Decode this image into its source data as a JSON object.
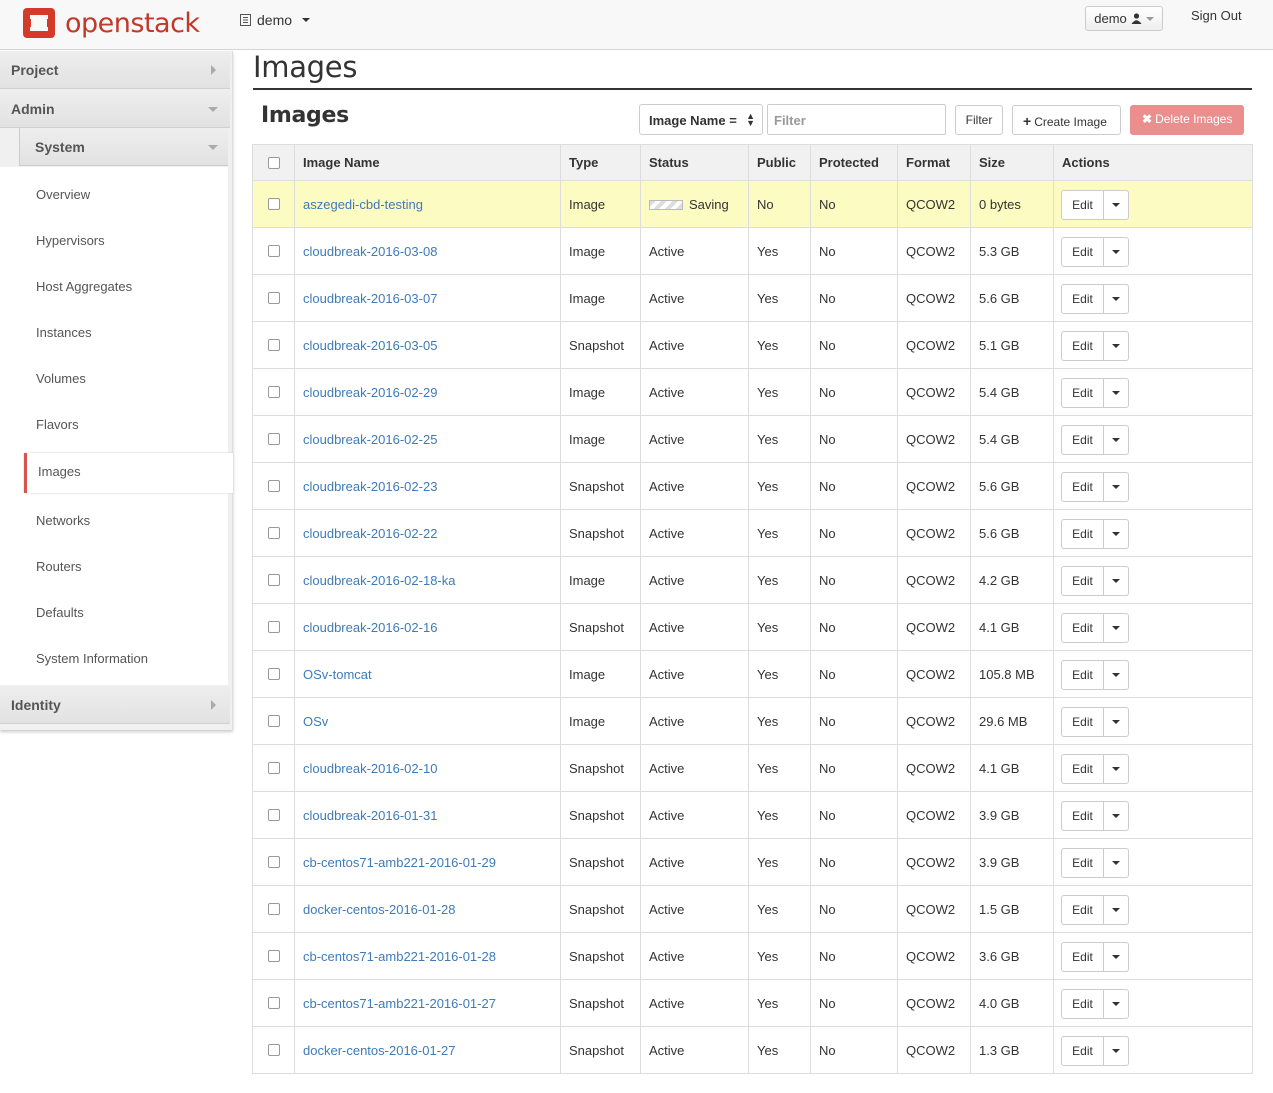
{
  "app": {
    "brand": "openstack",
    "brand_color": "#c0392b"
  },
  "topbar": {
    "project": "demo",
    "user": "demo",
    "signout": "Sign Out"
  },
  "sidebar": {
    "project": "Project",
    "admin": "Admin",
    "system": "System",
    "items": [
      "Overview",
      "Hypervisors",
      "Host Aggregates",
      "Instances",
      "Volumes",
      "Flavors",
      "Images",
      "Networks",
      "Routers",
      "Defaults",
      "System Information"
    ],
    "active": "Images",
    "identity": "Identity"
  },
  "page": {
    "title": "Images",
    "table_title": "Images"
  },
  "toolbar": {
    "filter_field": "Image Name =",
    "filter_placeholder": "Filter",
    "filter_button": "Filter",
    "create_button": "Create Image",
    "delete_button": "Delete Images"
  },
  "table": {
    "columns": [
      "Image Name",
      "Type",
      "Status",
      "Public",
      "Protected",
      "Format",
      "Size",
      "Actions"
    ],
    "action_label": "Edit",
    "rows": [
      {
        "name": "aszegedi-cbd-testing",
        "type": "Image",
        "status": "Saving",
        "public": "No",
        "protected": "No",
        "format": "QCOW2",
        "size": "0 bytes"
      },
      {
        "name": "cloudbreak-2016-03-08",
        "type": "Image",
        "status": "Active",
        "public": "Yes",
        "protected": "No",
        "format": "QCOW2",
        "size": "5.3 GB"
      },
      {
        "name": "cloudbreak-2016-03-07",
        "type": "Image",
        "status": "Active",
        "public": "Yes",
        "protected": "No",
        "format": "QCOW2",
        "size": "5.6 GB"
      },
      {
        "name": "cloudbreak-2016-03-05",
        "type": "Snapshot",
        "status": "Active",
        "public": "Yes",
        "protected": "No",
        "format": "QCOW2",
        "size": "5.1 GB"
      },
      {
        "name": "cloudbreak-2016-02-29",
        "type": "Image",
        "status": "Active",
        "public": "Yes",
        "protected": "No",
        "format": "QCOW2",
        "size": "5.4 GB"
      },
      {
        "name": "cloudbreak-2016-02-25",
        "type": "Image",
        "status": "Active",
        "public": "Yes",
        "protected": "No",
        "format": "QCOW2",
        "size": "5.4 GB"
      },
      {
        "name": "cloudbreak-2016-02-23",
        "type": "Snapshot",
        "status": "Active",
        "public": "Yes",
        "protected": "No",
        "format": "QCOW2",
        "size": "5.6 GB"
      },
      {
        "name": "cloudbreak-2016-02-22",
        "type": "Snapshot",
        "status": "Active",
        "public": "Yes",
        "protected": "No",
        "format": "QCOW2",
        "size": "5.6 GB"
      },
      {
        "name": "cloudbreak-2016-02-18-ka",
        "type": "Image",
        "status": "Active",
        "public": "Yes",
        "protected": "No",
        "format": "QCOW2",
        "size": "4.2 GB"
      },
      {
        "name": "cloudbreak-2016-02-16",
        "type": "Snapshot",
        "status": "Active",
        "public": "Yes",
        "protected": "No",
        "format": "QCOW2",
        "size": "4.1 GB"
      },
      {
        "name": "OSv-tomcat",
        "type": "Image",
        "status": "Active",
        "public": "Yes",
        "protected": "No",
        "format": "QCOW2",
        "size": "105.8 MB"
      },
      {
        "name": "OSv",
        "type": "Image",
        "status": "Active",
        "public": "Yes",
        "protected": "No",
        "format": "QCOW2",
        "size": "29.6 MB"
      },
      {
        "name": "cloudbreak-2016-02-10",
        "type": "Snapshot",
        "status": "Active",
        "public": "Yes",
        "protected": "No",
        "format": "QCOW2",
        "size": "4.1 GB"
      },
      {
        "name": "cloudbreak-2016-01-31",
        "type": "Snapshot",
        "status": "Active",
        "public": "Yes",
        "protected": "No",
        "format": "QCOW2",
        "size": "3.9 GB"
      },
      {
        "name": "cb-centos71-amb221-2016-01-29",
        "type": "Snapshot",
        "status": "Active",
        "public": "Yes",
        "protected": "No",
        "format": "QCOW2",
        "size": "3.9 GB"
      },
      {
        "name": "docker-centos-2016-01-28",
        "type": "Snapshot",
        "status": "Active",
        "public": "Yes",
        "protected": "No",
        "format": "QCOW2",
        "size": "1.5 GB"
      },
      {
        "name": "cb-centos71-amb221-2016-01-28",
        "type": "Snapshot",
        "status": "Active",
        "public": "Yes",
        "protected": "No",
        "format": "QCOW2",
        "size": "3.6 GB"
      },
      {
        "name": "cb-centos71-amb221-2016-01-27",
        "type": "Snapshot",
        "status": "Active",
        "public": "Yes",
        "protected": "No",
        "format": "QCOW2",
        "size": "4.0 GB"
      },
      {
        "name": "docker-centos-2016-01-27",
        "type": "Snapshot",
        "status": "Active",
        "public": "Yes",
        "protected": "No",
        "format": "QCOW2",
        "size": "1.3 GB"
      }
    ]
  }
}
